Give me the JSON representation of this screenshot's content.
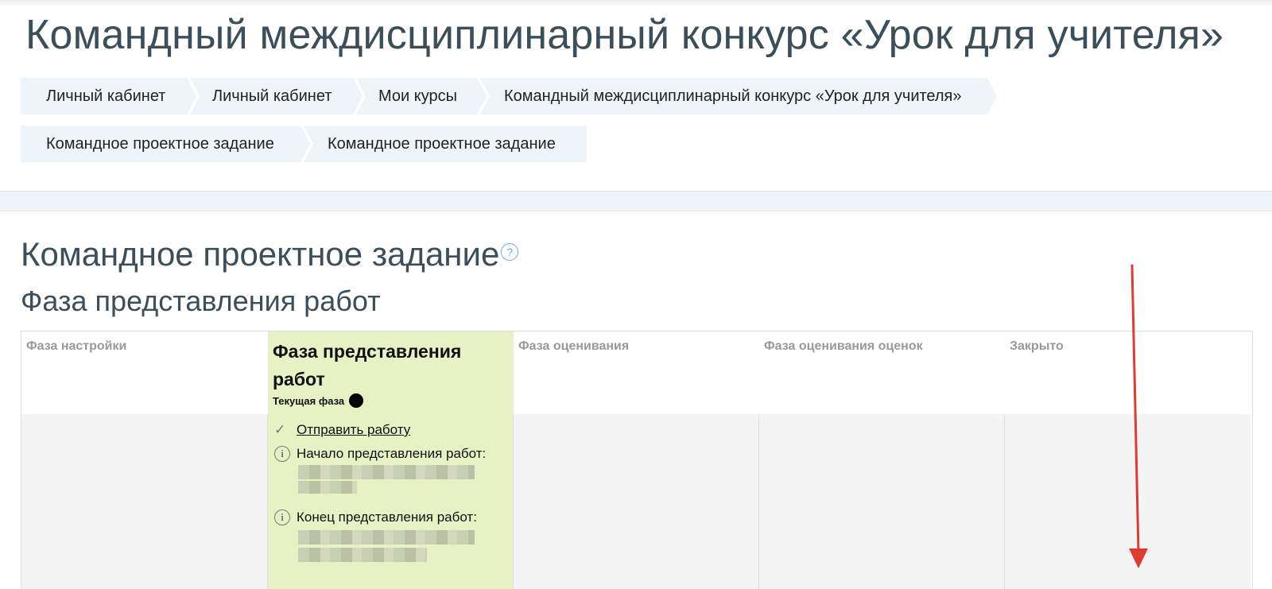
{
  "page_title": "Командный междисциплинарный конкурс «Урок для учителя»",
  "breadcrumbs_row1": [
    "Личный кабинет",
    "Личный кабинет",
    "Мои курсы",
    "Командный междисциплинарный конкурс «Урок для учителя»"
  ],
  "breadcrumbs_row2": [
    "Командное проектное задание",
    "Командное проектное задание"
  ],
  "activity_title": "Командное проектное задание",
  "help_symbol": "?",
  "phase_heading": "Фаза представления работ",
  "phases": {
    "setup": "Фаза настройки",
    "submission": "Фаза представления работ",
    "assessment": "Фаза оценивания",
    "grading_evaluation": "Фаза оценивания оценок",
    "closed": "Закрыто"
  },
  "current_phase_label": "Текущая фаза",
  "tasks": {
    "submit_link": "Отправить работу",
    "submissions_start_label": "Начало представления работ:",
    "submissions_end_label": "Конец представления работ:"
  },
  "colors": {
    "heading": "#3b4e59",
    "breadcrumb_bg": "#eef4f7",
    "active_phase_bg": "#e7f1c4",
    "annotation_arrow": "#e03a32"
  }
}
